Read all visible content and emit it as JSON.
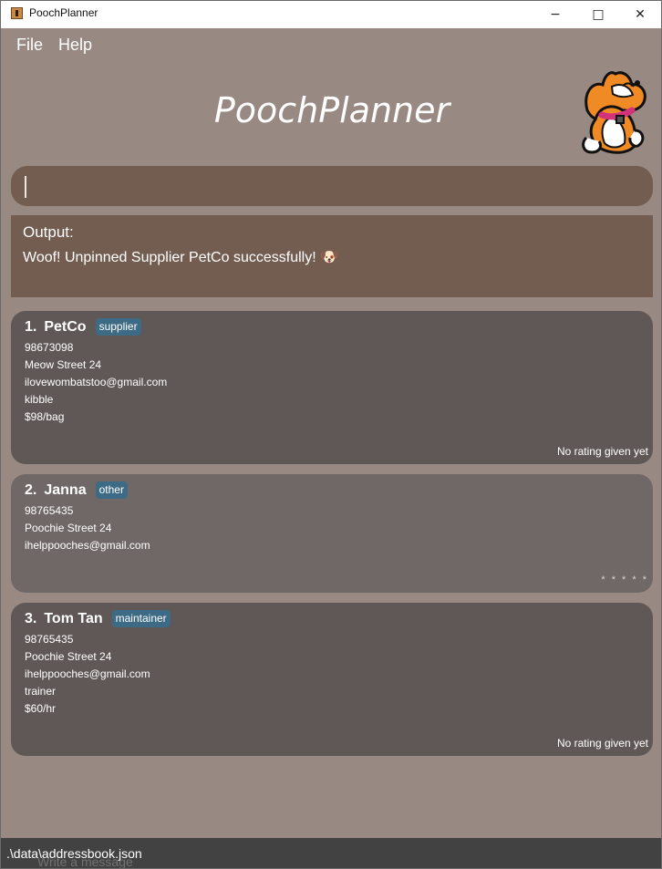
{
  "window": {
    "title": "PoochPlanner",
    "controls": {
      "minimize": "−",
      "maximize": "□",
      "close": "✕"
    }
  },
  "menu": {
    "file": "File",
    "help": "Help"
  },
  "header": {
    "title": "PoochPlanner",
    "mascot": "corgi-mascot"
  },
  "command": {
    "value": "",
    "placeholder": ""
  },
  "output": {
    "label": "Output:",
    "message": "Woof! Unpinned Supplier PetCo successfully! 🐶"
  },
  "contacts": [
    {
      "index": "1.",
      "name": "PetCo",
      "tag": "supplier",
      "phone": "98673098",
      "address": "Meow Street 24",
      "email": "ilovewombatstoo@gmail.com",
      "product": "kibble",
      "price": "$98/bag",
      "rating": "No rating given yet"
    },
    {
      "index": "2.",
      "name": "Janna",
      "tag": "other",
      "phone": "98765435",
      "address": "Poochie Street 24",
      "email": "ihelppooches@gmail.com",
      "rating": "* * * * *"
    },
    {
      "index": "3.",
      "name": "Tom Tan",
      "tag": "maintainer",
      "phone": "98765435",
      "address": "Poochie Street 24",
      "email": "ihelppooches@gmail.com",
      "skill": "trainer",
      "salary": "$60/hr",
      "rating": "No rating given yet"
    }
  ],
  "status": {
    "path": ".\\data\\addressbook.json",
    "underlay": "Write a message"
  },
  "colors": {
    "background": "#988a82",
    "panel": "#735c50",
    "card": "#5f5856",
    "card_alt": "#6f6866",
    "tag": "#3d6b86",
    "statusbar": "#424242"
  }
}
